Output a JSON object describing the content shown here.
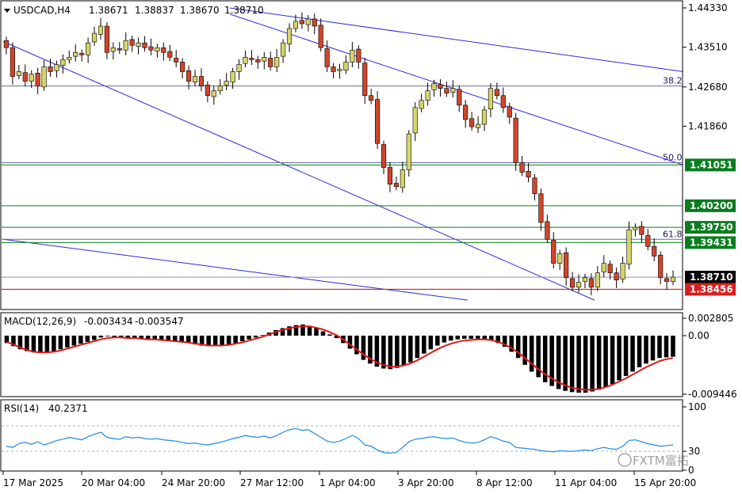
{
  "header": {
    "symbol": "USDCAD,H4",
    "open": "1.38671",
    "high": "1.38837",
    "low": "1.38670",
    "close": "1.38710"
  },
  "colors": {
    "bull_candle": "#d6d46a",
    "bear_candle": "#d2452a",
    "trend_line": "#2b2bd6",
    "fib_line": "#6a6aa0",
    "level_green": "#0a7d1e",
    "level_red": "#d62020",
    "macd_hist": "#000000",
    "macd_signal": "#e01818",
    "rsi_line": "#1e88e5"
  },
  "chart_data": [
    {
      "type": "candlestick",
      "title": "USDCAD,H4",
      "y_ticks": [
        "1.44330",
        "1.43510",
        "1.42680",
        "1.41860"
      ],
      "ylim": [
        1.3805,
        1.4433
      ],
      "price_labels": [
        {
          "value": "1.41051",
          "level": 1.41051,
          "kind": "support"
        },
        {
          "value": "1.40200",
          "level": 1.402,
          "kind": "support"
        },
        {
          "value": "1.39750",
          "level": 1.3975,
          "kind": "support"
        },
        {
          "value": "1.39431",
          "level": 1.39431,
          "kind": "support"
        },
        {
          "value": "1.38710",
          "level": 1.3871,
          "kind": "current"
        },
        {
          "value": "1.38456",
          "level": 1.38456,
          "kind": "resistance"
        }
      ],
      "fib_labels": [
        {
          "text": "38.2",
          "level": 1.427
        },
        {
          "text": "50.0",
          "level": 1.411
        },
        {
          "text": "61.8",
          "level": 1.395
        }
      ],
      "trend_lines": [
        {
          "from": [
            "17 Mar 2025",
            1.4363
          ],
          "to": [
            "11 Apr 04:00",
            1.3823
          ]
        },
        {
          "from": [
            "17 Mar 2025",
            1.395
          ],
          "to": [
            "11 Apr 04:00",
            1.3823
          ]
        },
        {
          "from": [
            "27 Mar 12:00",
            1.4433
          ],
          "to": [
            "15 Apr 20:00",
            1.43
          ]
        },
        {
          "from": [
            "27 Mar 12:00",
            1.442
          ],
          "to": [
            "15 Apr 20:00",
            1.4105
          ]
        }
      ],
      "closes": [
        1.435,
        1.429,
        1.43,
        1.428,
        1.4295,
        1.427,
        1.431,
        1.43,
        1.4315,
        1.4325,
        1.433,
        1.434,
        1.4335,
        1.436,
        1.438,
        1.4395,
        1.434,
        1.435,
        1.4345,
        1.4365,
        1.4355,
        1.436,
        1.435,
        1.4345,
        1.435,
        1.434,
        1.433,
        1.432,
        1.43,
        1.428,
        1.429,
        1.427,
        1.425,
        1.426,
        1.427,
        1.428,
        1.43,
        1.4315,
        1.433,
        1.4325,
        1.432,
        1.433,
        1.431,
        1.433,
        1.436,
        1.439,
        1.4405,
        1.44,
        1.441,
        1.4395,
        1.435,
        1.431,
        1.43,
        1.4305,
        1.432,
        1.4345,
        1.432,
        1.425,
        1.424,
        1.415,
        1.41,
        1.4065,
        1.406,
        1.4095,
        1.417,
        1.4225,
        1.424,
        1.426,
        1.4275,
        1.4265,
        1.4255,
        1.4265,
        1.423,
        1.42,
        1.4185,
        1.419,
        1.422,
        1.4265,
        1.425,
        1.4225,
        1.4205,
        1.411,
        1.409,
        1.408,
        1.4045,
        1.3985,
        1.395,
        1.39,
        1.392,
        1.387,
        1.385,
        1.386,
        1.387,
        1.385,
        1.388,
        1.39,
        1.388,
        1.3865,
        1.39,
        1.397,
        1.3975,
        1.396,
        1.3935,
        1.3915,
        1.387,
        1.3862,
        1.3871
      ],
      "price_line": 1.3871
    },
    {
      "type": "bar",
      "name": "MACD(12,26,9)",
      "title": "MACD(12,26,9)",
      "value_main": "-0.003434",
      "value_signal": "-0.003547",
      "y_ticks": [
        "0.002805",
        "0.00",
        "-0.009446"
      ],
      "ylim": [
        -0.009446,
        0.002805
      ],
      "histogram": [
        -0.0012,
        -0.0017,
        -0.0022,
        -0.0025,
        -0.0027,
        -0.0028,
        -0.0027,
        -0.0025,
        -0.0022,
        -0.0019,
        -0.0016,
        -0.0013,
        -0.001,
        -0.0007,
        -0.0003,
        -0.0001,
        -0.0002,
        -0.0003,
        -0.0004,
        -0.0005,
        -0.0005,
        -0.0006,
        -0.0007,
        -0.0008,
        -0.0009,
        -0.001,
        -0.0011,
        -0.0012,
        -0.0014,
        -0.0016,
        -0.0017,
        -0.0017,
        -0.0016,
        -0.0014,
        -0.0012,
        -0.0009,
        -0.0006,
        -0.0003,
        0.0001,
        0.0005,
        0.0009,
        0.0012,
        0.0015,
        0.0017,
        0.0018,
        0.0016,
        0.0012,
        0.0007,
        0.0002,
        -0.0004,
        -0.0012,
        -0.0021,
        -0.003,
        -0.0039,
        -0.0045,
        -0.005,
        -0.0053,
        -0.0054,
        -0.0052,
        -0.0048,
        -0.0043,
        -0.0036,
        -0.0029,
        -0.0022,
        -0.0016,
        -0.0011,
        -0.0008,
        -0.0006,
        -0.0005,
        -0.0005,
        -0.0005,
        -0.0006,
        -0.0008,
        -0.0012,
        -0.0018,
        -0.0026,
        -0.0036,
        -0.0047,
        -0.0058,
        -0.0067,
        -0.0075,
        -0.0081,
        -0.0086,
        -0.0089,
        -0.0091,
        -0.0092,
        -0.0092,
        -0.009,
        -0.0087,
        -0.0083,
        -0.0078,
        -0.0072,
        -0.0065,
        -0.0058,
        -0.0051,
        -0.0045,
        -0.004,
        -0.0036,
        -0.0035,
        -0.0034
      ],
      "signal": [
        -0.001,
        -0.0014,
        -0.0019,
        -0.0023,
        -0.0026,
        -0.0027,
        -0.0027,
        -0.0026,
        -0.0024,
        -0.0021,
        -0.0018,
        -0.0015,
        -0.0012,
        -0.0009,
        -0.0006,
        -0.0004,
        -0.0003,
        -0.0003,
        -0.0004,
        -0.0004,
        -0.0005,
        -0.0006,
        -0.0006,
        -0.0007,
        -0.0008,
        -0.0009,
        -0.001,
        -0.0011,
        -0.0013,
        -0.0014,
        -0.0016,
        -0.0016,
        -0.0016,
        -0.0015,
        -0.0013,
        -0.0011,
        -0.0008,
        -0.0005,
        -0.0002,
        0.0002,
        0.0006,
        0.0009,
        0.0012,
        0.0014,
        0.0015,
        0.0015,
        0.0013,
        0.001,
        0.0006,
        0.0001,
        -0.0006,
        -0.0014,
        -0.0022,
        -0.003,
        -0.0037,
        -0.0043,
        -0.0047,
        -0.005,
        -0.005,
        -0.0048,
        -0.0045,
        -0.004,
        -0.0034,
        -0.0028,
        -0.0022,
        -0.0017,
        -0.0013,
        -0.001,
        -0.0008,
        -0.0007,
        -0.0006,
        -0.0006,
        -0.0007,
        -0.001,
        -0.0014,
        -0.002,
        -0.0027,
        -0.0036,
        -0.0045,
        -0.0054,
        -0.0062,
        -0.0069,
        -0.0075,
        -0.008,
        -0.0084,
        -0.0086,
        -0.0087,
        -0.0087,
        -0.0086,
        -0.0083,
        -0.0079,
        -0.0074,
        -0.0069,
        -0.0063,
        -0.0057,
        -0.0051,
        -0.0046,
        -0.0041,
        -0.0038,
        -0.0036
      ]
    },
    {
      "type": "line",
      "name": "RSI(14)",
      "title": "RSI(14)",
      "value": "40.2371",
      "y_ticks": [
        "100",
        "30",
        "0"
      ],
      "ylim": [
        0,
        100
      ],
      "levels": [
        70,
        30
      ],
      "values": [
        38,
        36,
        42,
        44,
        41,
        45,
        40,
        43,
        47,
        49,
        52,
        50,
        48,
        53,
        57,
        60,
        52,
        50,
        49,
        53,
        51,
        52,
        50,
        49,
        50,
        48,
        47,
        46,
        44,
        42,
        43,
        41,
        40,
        42,
        44,
        47,
        50,
        52,
        55,
        53,
        52,
        54,
        51,
        55,
        60,
        64,
        66,
        63,
        64,
        58,
        52,
        46,
        44,
        46,
        50,
        55,
        50,
        40,
        38,
        32,
        28,
        27,
        28,
        36,
        45,
        49,
        50,
        52,
        53,
        51,
        50,
        51,
        47,
        44,
        43,
        44,
        48,
        53,
        50,
        46,
        44,
        36,
        35,
        34,
        33,
        31,
        30,
        29,
        31,
        30,
        30,
        31,
        32,
        31,
        34,
        36,
        34,
        33,
        38,
        47,
        48,
        45,
        42,
        40,
        38,
        39,
        40
      ],
      "x_ticks": [
        "17 Mar 2025",
        "20 Mar 04:00",
        "24 Mar 20:00",
        "27 Mar 12:00",
        "1 Apr 04:00",
        "3 Apr 20:00",
        "8 Apr 12:00",
        "11 Apr 04:00",
        "15 Apr 20:00"
      ]
    }
  ],
  "watermark": {
    "text": "FXTM富拓"
  }
}
